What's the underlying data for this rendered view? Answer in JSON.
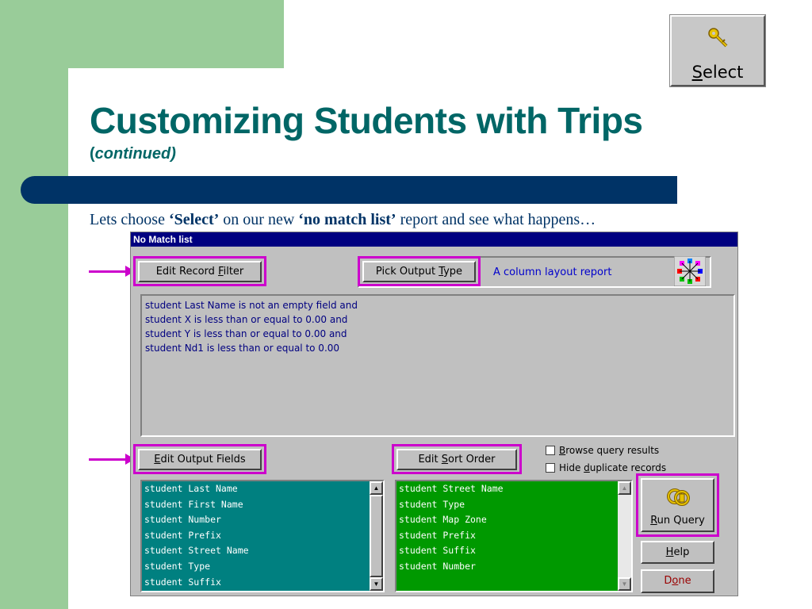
{
  "slide": {
    "title": "Customizing Students with Trips",
    "subtitle_open": "(",
    "subtitle_italic": "continued)",
    "caption_pre": "Lets choose ",
    "caption_bold1": "‘Select’",
    "caption_mid": " on our new ",
    "caption_bold2": "‘no match list’",
    "caption_post": " report and see what happens…"
  },
  "select_button": {
    "label_u": "S",
    "label_rest": "elect",
    "icon": "key-icon"
  },
  "window": {
    "title": "No Match list",
    "edit_record_filter": {
      "pre": "Edit Record ",
      "u": "F",
      "post": "ilter"
    },
    "pick_output_type": {
      "pre": "Pick Output ",
      "u": "T",
      "post": "ype"
    },
    "output_type_desc": "A column layout report",
    "filter_lines": [
      "student Last Name is not an empty field and",
      "student X is less than or equal to 0.00 and",
      "student Y is less than or equal to 0.00 and",
      "student Nd1 is less than or equal to 0.00"
    ],
    "edit_output_fields": {
      "u": "E",
      "post": "dit Output Fields"
    },
    "edit_sort_order": {
      "pre": "Edit ",
      "u": "S",
      "post": "ort Order"
    },
    "browse_query": {
      "u": "B",
      "post": "rowse query results"
    },
    "hide_duplicates": {
      "pre": "Hide ",
      "u": "d",
      "post": "uplicate records"
    },
    "output_fields": [
      "student Last Name",
      "student First Name",
      "student Number",
      "student Prefix",
      "student Street Name",
      "student Type",
      "student Suffix"
    ],
    "sort_fields": [
      "student Street Name",
      "student Type",
      "student Map Zone",
      "student Prefix",
      "student Suffix",
      "student Number"
    ],
    "run_query": {
      "u": "R",
      "post": "un Query",
      "icon": "keys-icon"
    },
    "help": {
      "u": "H",
      "post": "elp"
    },
    "done": {
      "pre": "D",
      "u": "o",
      "post": "ne"
    }
  },
  "colors": {
    "title": "#006666",
    "bar": "#003366",
    "highlight": "#cc00cc",
    "output_list_bg": "#008080",
    "sort_list_bg": "#009900"
  }
}
